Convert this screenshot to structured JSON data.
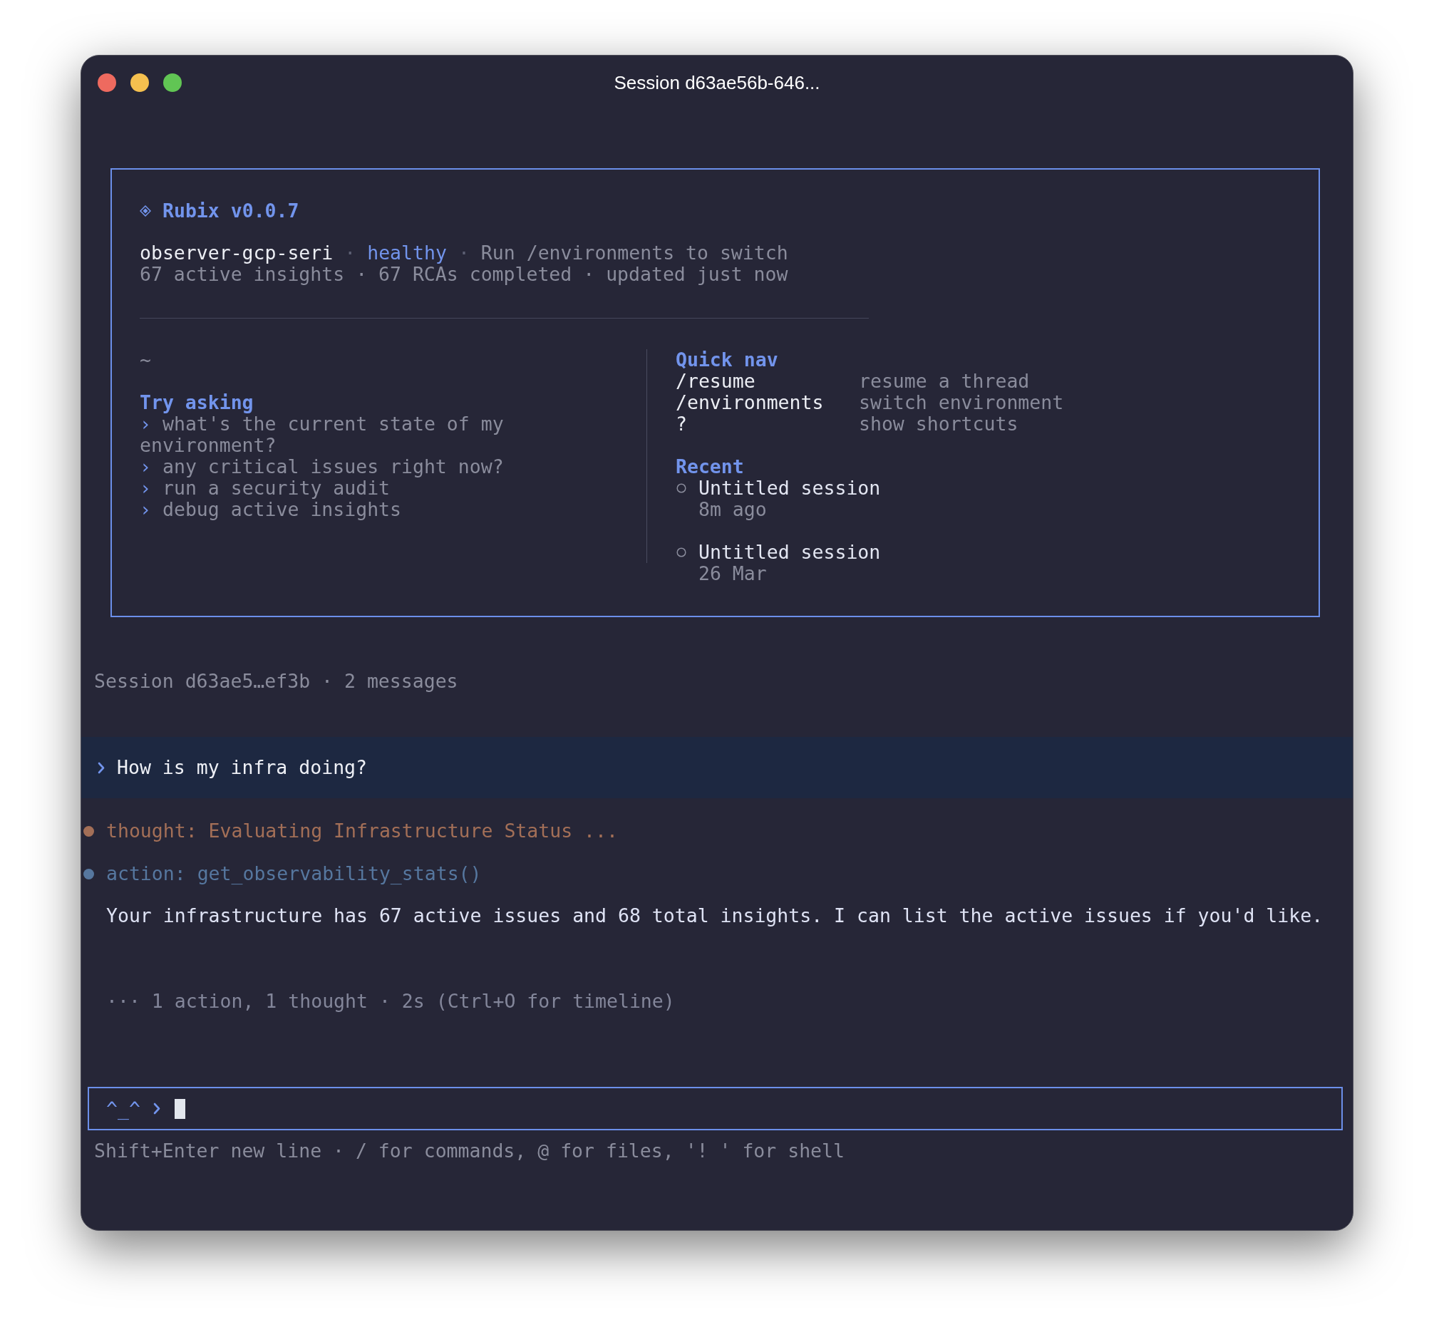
{
  "window": {
    "title": "Session d63ae56b-646..."
  },
  "banner": {
    "product": "Rubix v0.0.7",
    "status_line": [
      {
        "kind": "environment",
        "text": "observer-gcp-seri"
      },
      {
        "kind": "separator",
        "text": "·"
      },
      {
        "kind": "status",
        "text": "healthy"
      },
      {
        "kind": "separator",
        "text": "·"
      },
      {
        "kind": "hint",
        "text": "Run /environments to switch"
      }
    ],
    "stats": "67 active insights · 67 RCAs completed · updated just now",
    "path": "~",
    "try_asking": {
      "heading": "Try asking",
      "items": [
        {
          "marker": "›",
          "text": "what's the current state of my environment?"
        },
        {
          "marker": "›",
          "text": "any critical issues right now?"
        },
        {
          "marker": "›",
          "text": "run a security audit"
        },
        {
          "marker": "›",
          "text": "debug active insights"
        }
      ]
    },
    "quick_nav": {
      "heading": "Quick nav",
      "items": [
        {
          "command": "/resume",
          "description": "resume a thread"
        },
        {
          "command": "/environments",
          "description": "switch environment"
        },
        {
          "command": "?",
          "description": "show shortcuts"
        }
      ]
    },
    "recent": {
      "heading": "Recent",
      "items": [
        {
          "title": "Untitled session",
          "time": "8m ago"
        },
        {
          "title": "Untitled session",
          "time": "26 Mar"
        }
      ]
    }
  },
  "session_info": "Session d63ae5…ef3b · 2 messages",
  "conversation": {
    "user_message": "How is my infra doing?",
    "activity": [
      {
        "color": "#a36f57",
        "text": "thought: Evaluating Infrastructure Status ..."
      },
      {
        "color": "#56779f",
        "text": "action: get_observability_stats()"
      }
    ],
    "response": "Your infrastructure has 67 active issues and 68 total insights. I can list the active issues if you'd like.",
    "summary": "··· 1 action, 1 thought · 2s (Ctrl+O for timeline)"
  },
  "input": {
    "prompt": "^_^"
  },
  "hint": "Shift+Enter new line · / for commands, @ for files, '! ' for shell"
}
